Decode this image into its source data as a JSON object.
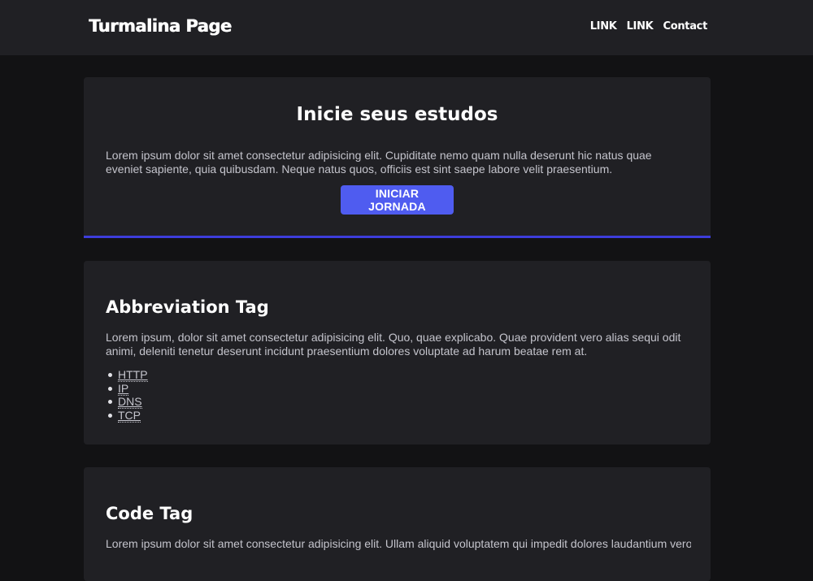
{
  "header": {
    "brand": "Turmalina Page",
    "nav": [
      "LINK",
      "LINK",
      "Contact"
    ]
  },
  "hero": {
    "title": "Inicie seus estudos",
    "text": "Lorem ipsum dolor sit amet consectetur adipisicing elit. Cupiditate nemo quam nulla deserunt hic natus quae eveniet sapiente, quia quibusdam. Neque natus quos, officiis est sint saepe labore velit praesentium.",
    "button": "INICIAR JORNADA"
  },
  "abbreviation": {
    "title": "Abbreviation Tag",
    "text": "Lorem ipsum, dolor sit amet consectetur adipisicing elit. Quo, quae explicabo. Quae provident vero alias sequi odit animi, deleniti tenetur deserunt incidunt praesentium dolores voluptate ad harum beatae rem at.",
    "items": [
      "HTTP",
      "IP",
      "DNS",
      "TCP"
    ]
  },
  "code": {
    "title": "Code Tag",
    "text": "Lorem ipsum dolor sit amet consectetur adipisicing elit. Ullam aliquid voluptatem qui impedit dolores laudantium vero"
  },
  "colors": {
    "background": "#121214",
    "surface": "#202024",
    "accent": "#4f5cf0",
    "accent_border": "#3d3ddb"
  }
}
